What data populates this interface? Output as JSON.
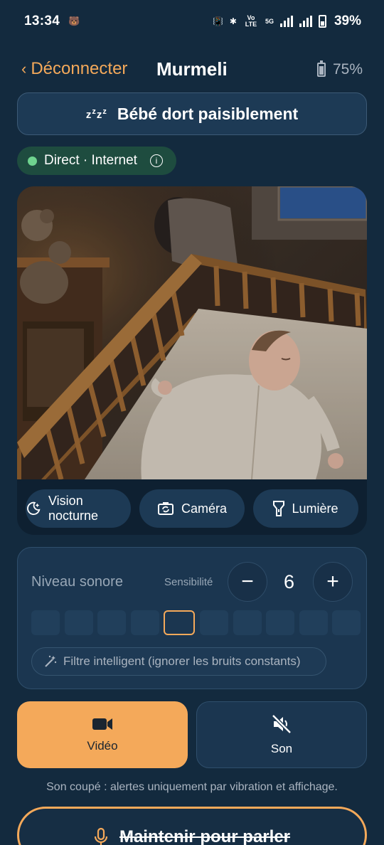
{
  "status_bar": {
    "time": "13:34",
    "battery_percent": "39%",
    "network": "5G",
    "volte": "Vo LTE"
  },
  "header": {
    "back_label": "Déconnecter",
    "title": "Murmeli",
    "device_battery": "75%"
  },
  "banner": {
    "icon": "sleep-zzz-icon",
    "message": "Bébé dort paisiblement"
  },
  "connection": {
    "label": "Direct · Internet",
    "status_color": "#6fd38f"
  },
  "video_controls": [
    {
      "label": "Vision nocturne",
      "icon": "moon-stars-icon"
    },
    {
      "label": "Caméra",
      "icon": "camera-switch-icon"
    },
    {
      "label": "Lumière",
      "icon": "flashlight-icon"
    }
  ],
  "sound": {
    "title": "Niveau sonore",
    "sensitivity_label": "Sensibilité",
    "sensitivity_value": "6",
    "minus": "−",
    "plus": "+",
    "meter_segments": 10,
    "meter_selected_index": 4,
    "filter_label": "Filtre intelligent (ignorer les bruits constants)"
  },
  "modes": {
    "video_label": "Vidéo",
    "sound_label": "Son"
  },
  "mute_note": "Son coupé : alertes uniquement par vibration et affichage.",
  "talk_button": "Maintenir pour parler",
  "colors": {
    "accent": "#f4a95a",
    "background": "#132a3e",
    "card": "#1b3650",
    "online": "#6fd38f"
  }
}
